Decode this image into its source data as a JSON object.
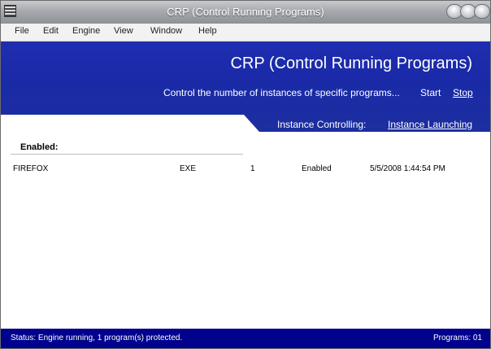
{
  "window": {
    "title": "CRP (Control Running Programs)"
  },
  "menu": [
    "File",
    "Edit",
    "Engine",
    "View",
    "Window",
    "Help"
  ],
  "header": {
    "title": "CRP (Control Running Programs)",
    "description": "Control the number of instances of specific programs...",
    "start_label": "Start",
    "stop_label": "Stop",
    "tabs": {
      "controlling": "Instance Controlling:",
      "launching": "Instance Launching"
    }
  },
  "section": {
    "label": "Enabled:"
  },
  "rows": [
    {
      "name": "FIREFOX",
      "type": "EXE",
      "count": "1",
      "state": "Enabled",
      "date": "5/5/2008 1:44:54 PM"
    }
  ],
  "status": {
    "text": "Status:  Engine running, 1 program(s) protected.",
    "programs": "Programs:  01"
  },
  "colors": {
    "header_bg": "#1f2db0",
    "status_bg": "#00018c",
    "title_text": "#ffffff"
  }
}
